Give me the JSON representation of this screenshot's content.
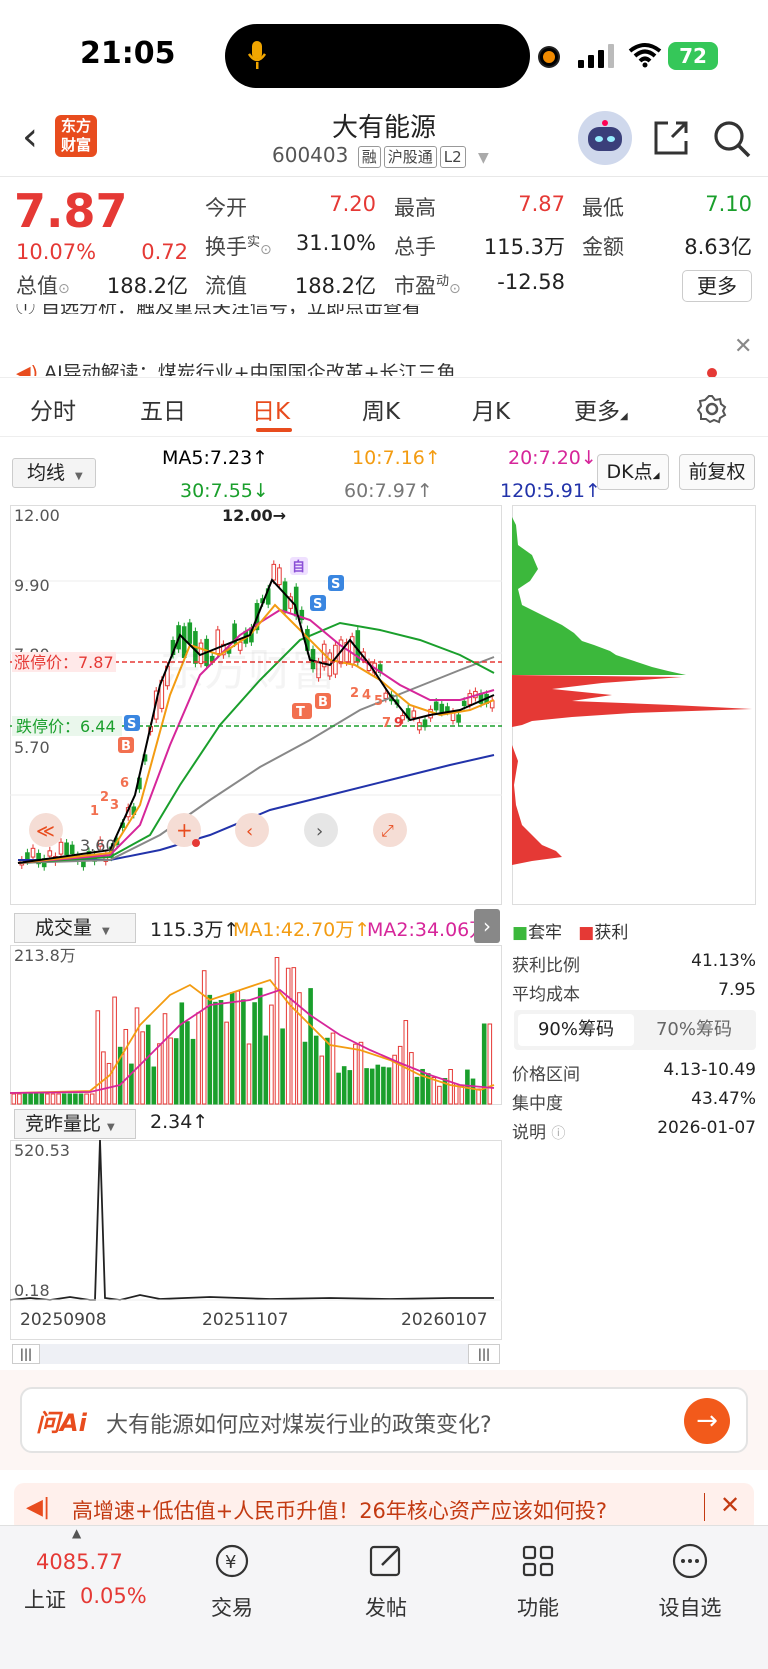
{
  "status": {
    "time": "21:05",
    "battery": "72"
  },
  "header": {
    "logo_text": "东方财富",
    "name": "大有能源",
    "code": "600403",
    "tags": [
      "融",
      "沪股通",
      "L2"
    ]
  },
  "quote": {
    "price": "7.87",
    "pct": "10.07%",
    "change": "0.72",
    "stats": [
      {
        "label": "今开",
        "value": "7.20",
        "color": "red"
      },
      {
        "label": "最高",
        "value": "7.87",
        "color": "red"
      },
      {
        "label": "最低",
        "value": "7.10",
        "color": "green"
      },
      {
        "label": "换手",
        "sup": "实",
        "value": "31.10%",
        "color": "black"
      },
      {
        "label": "总手",
        "value": "115.3万",
        "color": "black"
      },
      {
        "label": "金额",
        "value": "8.63亿",
        "color": "black"
      },
      {
        "label": "总值",
        "value": "188.2亿",
        "color": "black"
      },
      {
        "label": "流值",
        "value": "188.2亿",
        "color": "black"
      },
      {
        "label": "市盈",
        "sup": "动",
        "value": "-12.58",
        "color": "black"
      }
    ],
    "more": "更多"
  },
  "ai_news": {
    "line1": "ⓘ 自选分析：触及重点关注信号，立即点击查看",
    "line2": "AI异动解读：煤炭行业+中国国企改革+长江三角"
  },
  "tabs": [
    "分时",
    "五日",
    "日K",
    "周K",
    "月K",
    "更多"
  ],
  "active_tab": "日K",
  "indicators": {
    "ma_selector": "均线",
    "ma5": "MA5:7.23↑",
    "ma10": "10:7.16↑",
    "ma20": "20:7.20↓",
    "ma30": "30:7.55↓",
    "ma60": "60:7.97↑",
    "ma120": "120:5.91↑",
    "dk": "DK点",
    "adjust": "前复权"
  },
  "colors": {
    "up": "#e53935",
    "down": "#1a9f2c",
    "accent": "#e84c1e",
    "ma5": "#000000",
    "ma10": "#f39c12",
    "ma20": "#d6269a",
    "ma30": "#1a9f2c",
    "ma60": "#888888",
    "ma120": "#2233aa"
  },
  "kline": {
    "y_labels": [
      "12.00",
      "9.90",
      "7.80",
      "5.70",
      "3.60"
    ],
    "max_marker": "12.00→",
    "limit_up": "涨停价：7.87",
    "limit_down": "跌停价：6.44"
  },
  "volume": {
    "selector": "成交量",
    "value": "115.3万↑",
    "ma1": "MA1:42.70万↑",
    "ma2": "MA2:34.06万↑",
    "y_max": "213.8万"
  },
  "ratio": {
    "selector": "竞昨量比",
    "value": "2.34↑",
    "y_max": "520.53",
    "y_min": "0.18",
    "dates": [
      "20250908",
      "20251107",
      "20260107"
    ]
  },
  "chips": {
    "legend_trapped": "套牢",
    "legend_profit": "获利",
    "profit_ratio_label": "获利比例",
    "profit_ratio": "41.13%",
    "avg_cost_label": "平均成本",
    "avg_cost": "7.95",
    "tab90": "90%筹码",
    "tab70": "70%筹码",
    "range_label": "价格区间",
    "range": "4.13-10.49",
    "conc_label": "集中度",
    "conc": "43.47%",
    "note_label": "说明",
    "note_date": "2026-01-07"
  },
  "ask": {
    "logo": "问Ai",
    "placeholder": "大有能源如何应对煤炭行业的政策变化?"
  },
  "promo": "高增速+低估值+人民币升值！26年核心资产应该如何投?",
  "tabbar": {
    "index_value": "4085.77",
    "index_name": "上证",
    "index_pct": "0.05%",
    "items": [
      "交易",
      "发帖",
      "功能",
      "设自选"
    ]
  }
}
